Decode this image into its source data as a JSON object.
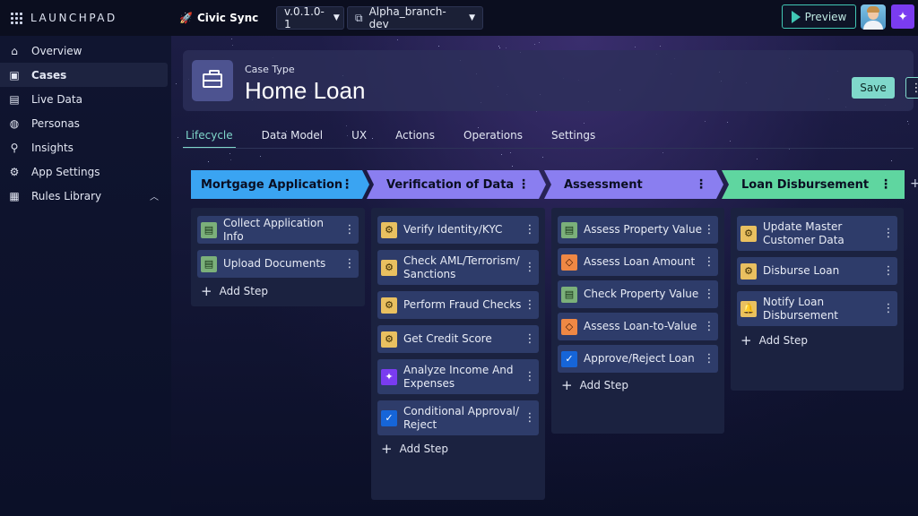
{
  "topbar": {
    "logo_text": "LAUNCHPAD",
    "app_name": "Civic Sync",
    "version": "v.0.1.0-1",
    "branch": "Alpha_branch-dev",
    "preview_label": "Preview"
  },
  "sidebar": {
    "items": [
      {
        "label": "Overview",
        "icon": "home-icon"
      },
      {
        "label": "Cases",
        "icon": "briefcase-icon"
      },
      {
        "label": "Live Data",
        "icon": "data-icon"
      },
      {
        "label": "Personas",
        "icon": "globe-icon"
      },
      {
        "label": "Insights",
        "icon": "insights-icon"
      },
      {
        "label": "App Settings",
        "icon": "gear-icon"
      },
      {
        "label": "Rules Library",
        "icon": "library-icon"
      }
    ]
  },
  "header": {
    "case_type_label": "Case Type",
    "title": "Home Loan",
    "save_label": "Save"
  },
  "tabs": [
    "Lifecycle",
    "Data Model",
    "UX",
    "Actions",
    "Operations",
    "Settings"
  ],
  "stages": [
    {
      "name": "Mortgage Application",
      "color": "#3aa4f2",
      "steps": [
        {
          "label": "Collect Application Info",
          "type": "green"
        },
        {
          "label": "Upload Documents",
          "type": "green"
        }
      ]
    },
    {
      "name": "Verification of Data",
      "color": "#8a7ef0",
      "steps": [
        {
          "label": "Verify Identity/KYC",
          "type": "yellow"
        },
        {
          "label": "Check AML/Terrorism/ Sanctions",
          "type": "yellow"
        },
        {
          "label": "Perform Fraud Checks",
          "type": "yellow"
        },
        {
          "label": "Get Credit Score",
          "type": "yellow"
        },
        {
          "label": "Analyze Income And Expenses",
          "type": "purple"
        },
        {
          "label": "Conditional Approval/ Reject",
          "type": "blue"
        }
      ]
    },
    {
      "name": "Assessment",
      "color": "#8a7ef0",
      "steps": [
        {
          "label": "Assess Property Value",
          "type": "green"
        },
        {
          "label": "Assess Loan Amount",
          "type": "orange"
        },
        {
          "label": "Check Property Value",
          "type": "green"
        },
        {
          "label": "Assess Loan-to-Value",
          "type": "orange"
        },
        {
          "label": "Approve/Reject Loan",
          "type": "blue"
        }
      ]
    },
    {
      "name": "Loan Disbursement",
      "color": "#5fd6a0",
      "steps": [
        {
          "label": "Update Master Customer Data",
          "type": "yellow"
        },
        {
          "label": "Disburse Loan",
          "type": "yellow"
        },
        {
          "label": "Notify Loan Disbursement",
          "type": "yellow-bell"
        }
      ]
    }
  ],
  "add_step_label": "Add Step"
}
